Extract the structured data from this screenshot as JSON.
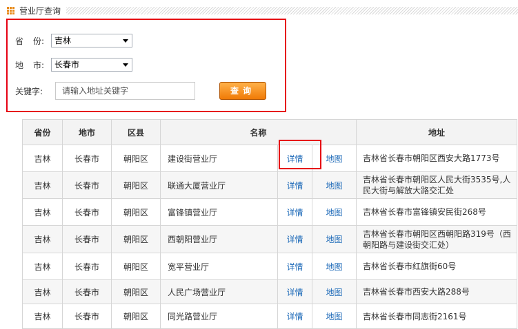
{
  "header": {
    "title": "营业厅查询"
  },
  "search": {
    "province_label_a": "省",
    "province_label_b": "份:",
    "province_value": "吉林",
    "city_label_a": "地",
    "city_label_b": "市:",
    "city_value": "长春市",
    "keyword_label": "关键字:",
    "keyword_placeholder": "请输入地址关键字",
    "submit_label": "查询"
  },
  "table": {
    "headers": [
      "省份",
      "地市",
      "区县",
      "名称",
      "地址"
    ],
    "detail_label": "详情",
    "map_label": "地图",
    "rows": [
      {
        "province": "吉林",
        "city": "长春市",
        "district": "朝阳区",
        "name": "建设街营业厅",
        "address": "吉林省长春市朝阳区西安大路1773号"
      },
      {
        "province": "吉林",
        "city": "长春市",
        "district": "朝阳区",
        "name": "联通大厦营业厅",
        "address": "吉林省长春市朝阳区人民大街3535号,人民大街与解放大路交汇处"
      },
      {
        "province": "吉林",
        "city": "长春市",
        "district": "朝阳区",
        "name": "富锋镇营业厅",
        "address": "吉林省长春市富锋镇安民街268号"
      },
      {
        "province": "吉林",
        "city": "长春市",
        "district": "朝阳区",
        "name": "西朝阳营业厅",
        "address": "吉林省长春市朝阳区西朝阳路319号（西朝阳路与建设街交汇处）"
      },
      {
        "province": "吉林",
        "city": "长春市",
        "district": "朝阳区",
        "name": "宽平营业厅",
        "address": "吉林省长春市红旗街60号"
      },
      {
        "province": "吉林",
        "city": "长春市",
        "district": "朝阳区",
        "name": "人民广场营业厅",
        "address": "吉林省长春市西安大路288号"
      },
      {
        "province": "吉林",
        "city": "长春市",
        "district": "朝阳区",
        "name": "同光路营业厅",
        "address": "吉林省长春市同志街2161号"
      }
    ]
  }
}
